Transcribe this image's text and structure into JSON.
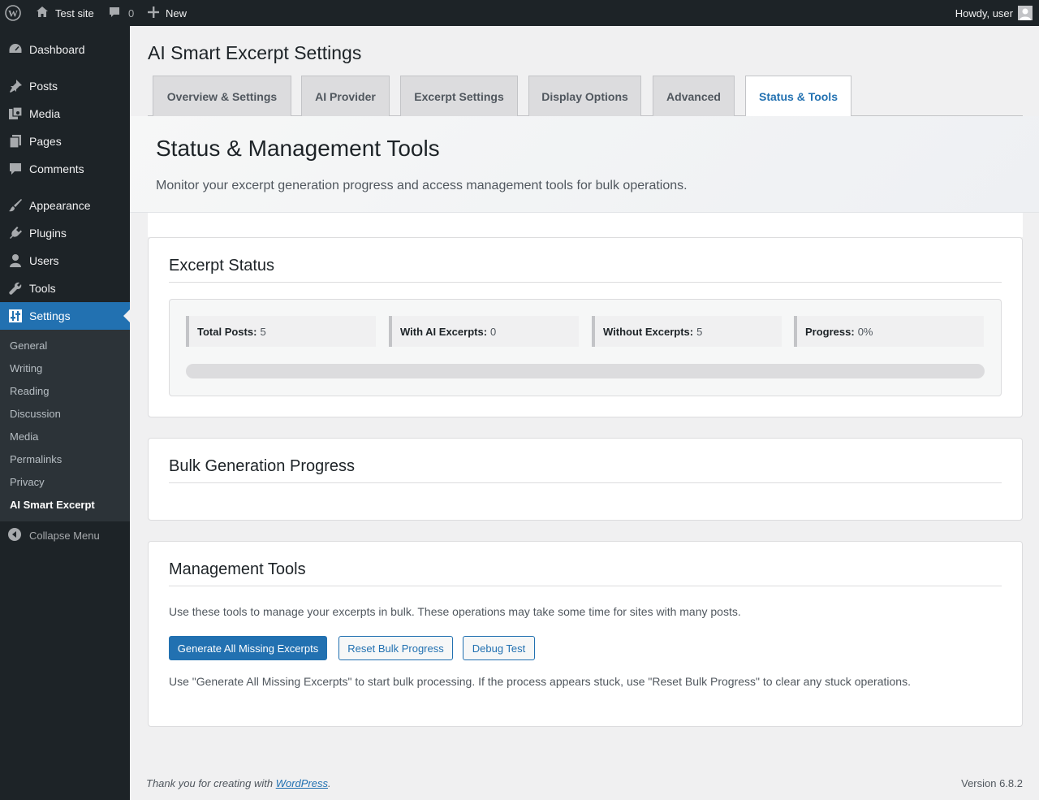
{
  "admin_bar": {
    "site_name": "Test site",
    "comments_count": "0",
    "new_label": "New",
    "howdy": "Howdy, user"
  },
  "sidebar": {
    "items": [
      {
        "label": "Dashboard",
        "icon": "dashboard-icon"
      },
      {
        "label": "Posts",
        "icon": "pin-icon"
      },
      {
        "label": "Media",
        "icon": "media-icon"
      },
      {
        "label": "Pages",
        "icon": "pages-icon"
      },
      {
        "label": "Comments",
        "icon": "comment-icon"
      },
      {
        "label": "Appearance",
        "icon": "brush-icon"
      },
      {
        "label": "Plugins",
        "icon": "plug-icon"
      },
      {
        "label": "Users",
        "icon": "user-icon"
      },
      {
        "label": "Tools",
        "icon": "wrench-icon"
      },
      {
        "label": "Settings",
        "icon": "settings-icon"
      }
    ],
    "submenu": [
      "General",
      "Writing",
      "Reading",
      "Discussion",
      "Media",
      "Permalinks",
      "Privacy",
      "AI Smart Excerpt"
    ],
    "collapse_label": "Collapse Menu"
  },
  "page": {
    "title": "AI Smart Excerpt Settings",
    "tabs": [
      "Overview & Settings",
      "AI Provider",
      "Excerpt Settings",
      "Display Options",
      "Advanced",
      "Status & Tools"
    ],
    "active_tab": "Status & Tools"
  },
  "hero": {
    "title": "Status & Management Tools",
    "subtitle": "Monitor your excerpt generation progress and access management tools for bulk operations."
  },
  "excerpt_status": {
    "title": "Excerpt Status",
    "stats": [
      {
        "label": "Total Posts:",
        "value": "5"
      },
      {
        "label": "With AI Excerpts:",
        "value": "0"
      },
      {
        "label": "Without Excerpts:",
        "value": "5"
      },
      {
        "label": "Progress:",
        "value": "0%"
      }
    ],
    "progress_fraction": 0
  },
  "bulk": {
    "title": "Bulk Generation Progress"
  },
  "management": {
    "title": "Management Tools",
    "intro": "Use these tools to manage your excerpts in bulk. These operations may take some time for sites with many posts.",
    "buttons": {
      "generate": "Generate All Missing Excerpts",
      "reset": "Reset Bulk Progress",
      "debug": "Debug Test"
    },
    "help": "Use \"Generate All Missing Excerpts\" to start bulk processing. If the process appears stuck, use \"Reset Bulk Progress\" to clear any stuck operations."
  },
  "footer": {
    "thanks_prefix": "Thank you for creating with ",
    "thanks_link": "WordPress",
    "thanks_suffix": ".",
    "version": "Version 6.8.2"
  },
  "colors": {
    "admin_dark": "#1d2327",
    "accent": "#2271b1",
    "submenu_bg": "#2c3338"
  }
}
